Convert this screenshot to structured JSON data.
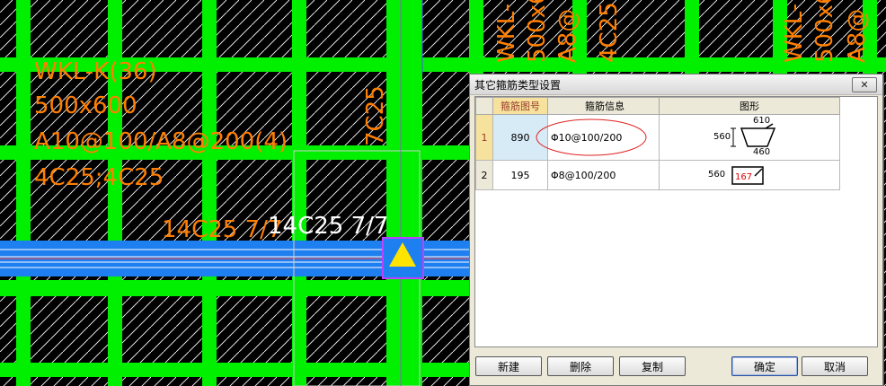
{
  "cad": {
    "beam_label": [
      "WKL-K(36)",
      "500x600",
      "A10@100/A8@200(4)",
      "4C25;4C25"
    ],
    "rebar_orange": "14C25 7/7",
    "rebar_white": "14C25 7/7",
    "vertical_beam_label": "7C25",
    "top_labels_1": [
      "WKL-",
      "500x6",
      "A8@",
      "4C25"
    ],
    "top_labels_2": [
      "WKL-",
      "500x6",
      "A8@"
    ],
    "colors": {
      "grid_green": "#00f000",
      "beam_blue": "#1e7ff0",
      "text_orange": "#ff7f00",
      "marker_yellow": "#ffe400"
    }
  },
  "dialog": {
    "title": "其它箍筋类型设置",
    "close_symbol": "✕",
    "columns": [
      "箍筋图号",
      "箍筋信息",
      "图形"
    ],
    "rows": [
      {
        "index": "1",
        "code": "890",
        "info": "Φ10@100/200",
        "shape_dims": {
          "left": "560",
          "top": "610",
          "bottom": "460"
        }
      },
      {
        "index": "2",
        "code": "195",
        "info": "Φ8@100/200",
        "shape_dims": {
          "left": "560",
          "inner": "167"
        }
      }
    ],
    "buttons": {
      "new": "新建",
      "delete": "删除",
      "copy": "复制",
      "ok": "确定",
      "cancel": "取消"
    }
  }
}
